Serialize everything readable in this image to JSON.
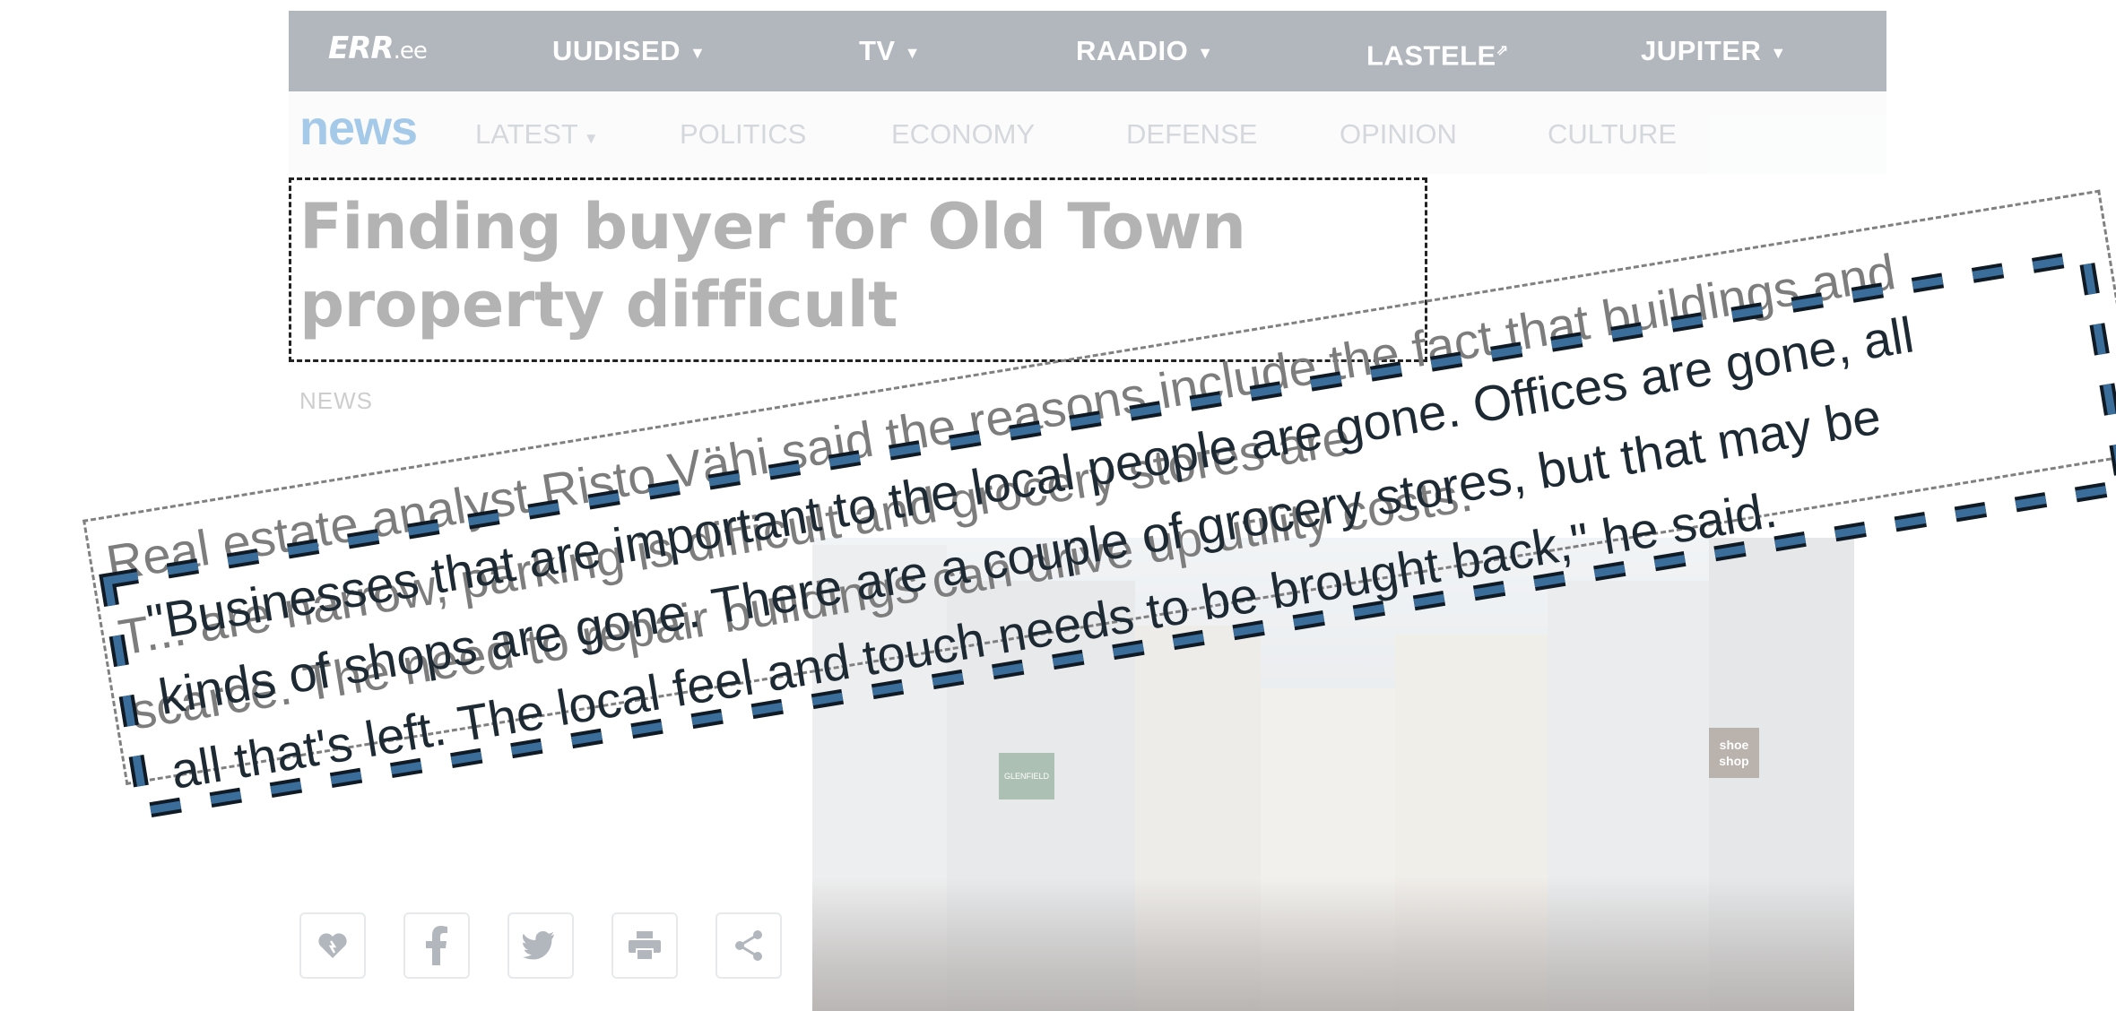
{
  "topnav": {
    "logo_main": "ERR",
    "logo_suffix": ".ee",
    "items": [
      {
        "label": "UUDISED",
        "caret": "▼"
      },
      {
        "label": "TV",
        "caret": "▼"
      },
      {
        "label": "RAADIO",
        "caret": "▼"
      },
      {
        "label": "LASTELE",
        "ext": "⇗"
      },
      {
        "label": "JUPITER",
        "caret": "▼"
      }
    ]
  },
  "subnav": {
    "brand": "news",
    "items": [
      {
        "label": "LATEST",
        "caret": "▼"
      },
      {
        "label": "POLITICS"
      },
      {
        "label": "ECONOMY"
      },
      {
        "label": "DEFENSE"
      },
      {
        "label": "OPINION"
      },
      {
        "label": "CULTURE"
      }
    ]
  },
  "article": {
    "headline": "Finding buyer for Old Town property difficult",
    "category": "NEWS",
    "paragraph_lines": [
      "Real estate analyst Risto Vähi said the reasons include the fact that buildings and",
      "T... are narrow, parking is difficult and grocery stores are",
      "scarce. The need to repair buildings can drive up utility costs."
    ],
    "quote_lines": [
      "\"Businesses that are important to the local people are gone. Offices are gone, all",
      "kinds of shops are gone. There are a couple of grocery stores, but that may be",
      "all that's left. The local feel and touch needs to be brought back,\" he said."
    ],
    "photo_signs": [
      "shoe shop",
      "GLENFIELD"
    ]
  },
  "share": [
    {
      "icon": "heart-icon"
    },
    {
      "icon": "facebook-icon"
    },
    {
      "icon": "twitter-icon"
    },
    {
      "icon": "print-icon"
    },
    {
      "icon": "share-icon"
    }
  ],
  "colors": {
    "topnav_bg": "#4a5666",
    "brand_blue": "#2a7fc9",
    "quote_dash_fill": "#3a6d9a",
    "quote_dash_stroke": "#0f1a24"
  }
}
